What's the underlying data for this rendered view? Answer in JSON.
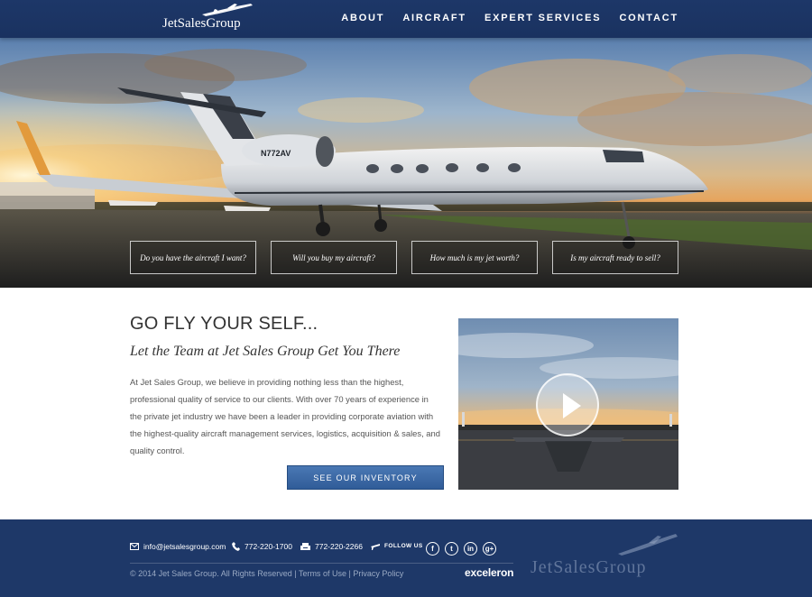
{
  "header": {
    "logo_text": "JetSalesGroup",
    "nav": [
      "ABOUT",
      "AIRCRAFT",
      "EXPERT SERVICES",
      "CONTACT"
    ]
  },
  "hero": {
    "tail_number": "N772AV",
    "buttons": [
      "Do you have the aircraft I want?",
      "Will you buy my aircraft?",
      "How much is my jet worth?",
      "Is my aircraft ready to sell?"
    ]
  },
  "content": {
    "title": "GO FLY YOUR SELF...",
    "subtitle": "Let the Team at Jet Sales Group Get You There",
    "body": "At Jet Sales Group, we believe in providing nothing less than the highest, professional quality of service to our clients. With over 70 years of experience in the private jet industry we have been a leader in providing corporate aviation with the highest-quality aircraft management services, logistics, acquisition & sales, and quality control.",
    "inventory_button": "SEE OUR INVENTORY"
  },
  "video": {
    "icon": "play-icon"
  },
  "footer": {
    "email": "info@jetsalesgroup.com",
    "phone": "772-220-1700",
    "fax": "772-220-2266",
    "follow_label": "FOLLOW US",
    "social": [
      {
        "name": "facebook-icon",
        "glyph": "f"
      },
      {
        "name": "twitter-icon",
        "glyph": "t"
      },
      {
        "name": "linkedin-icon",
        "glyph": "in"
      },
      {
        "name": "googleplus-icon",
        "glyph": "g+"
      }
    ],
    "copyright": "© 2014 Jet Sales Group. All Rights Reserved",
    "separator": "|",
    "terms": "Terms of Use",
    "privacy": "Privacy Policy",
    "exceleron": "exceleron",
    "logo_text": "JetSalesGroup"
  },
  "colors": {
    "header_bg": "#1d3768",
    "footer_bg": "#1e3868",
    "button_blue": "#3a68a6"
  }
}
